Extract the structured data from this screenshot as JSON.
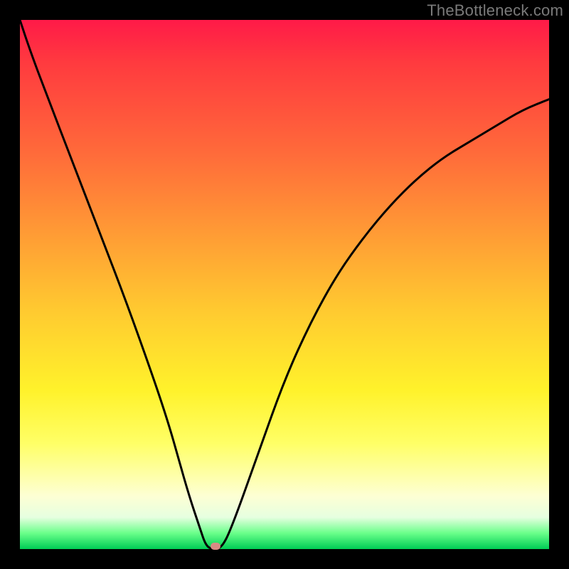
{
  "watermark": "TheBottleneck.com",
  "chart_data": {
    "type": "line",
    "title": "",
    "xlabel": "",
    "ylabel": "",
    "xlim": [
      0,
      100
    ],
    "ylim": [
      0,
      100
    ],
    "series": [
      {
        "name": "curve",
        "x": [
          0,
          2,
          5,
          10,
          15,
          20,
          25,
          28,
          30,
          32,
          34,
          35,
          36,
          38,
          40,
          45,
          50,
          55,
          60,
          65,
          70,
          75,
          80,
          85,
          90,
          95,
          100
        ],
        "y": [
          100,
          94,
          86,
          73,
          60,
          47,
          33,
          24,
          17,
          10,
          4,
          1,
          0,
          0,
          4,
          18,
          32,
          43,
          52,
          59,
          65,
          70,
          74,
          77,
          80,
          83,
          85
        ]
      }
    ],
    "marker": {
      "x": 37,
      "y": 0.5
    },
    "gradient_stops": [
      {
        "pos": 0,
        "color": "#ff1a48"
      },
      {
        "pos": 25,
        "color": "#ff6a3a"
      },
      {
        "pos": 55,
        "color": "#ffca30"
      },
      {
        "pos": 80,
        "color": "#ffff66"
      },
      {
        "pos": 97,
        "color": "#6aff8a"
      },
      {
        "pos": 100,
        "color": "#00cc55"
      }
    ]
  }
}
